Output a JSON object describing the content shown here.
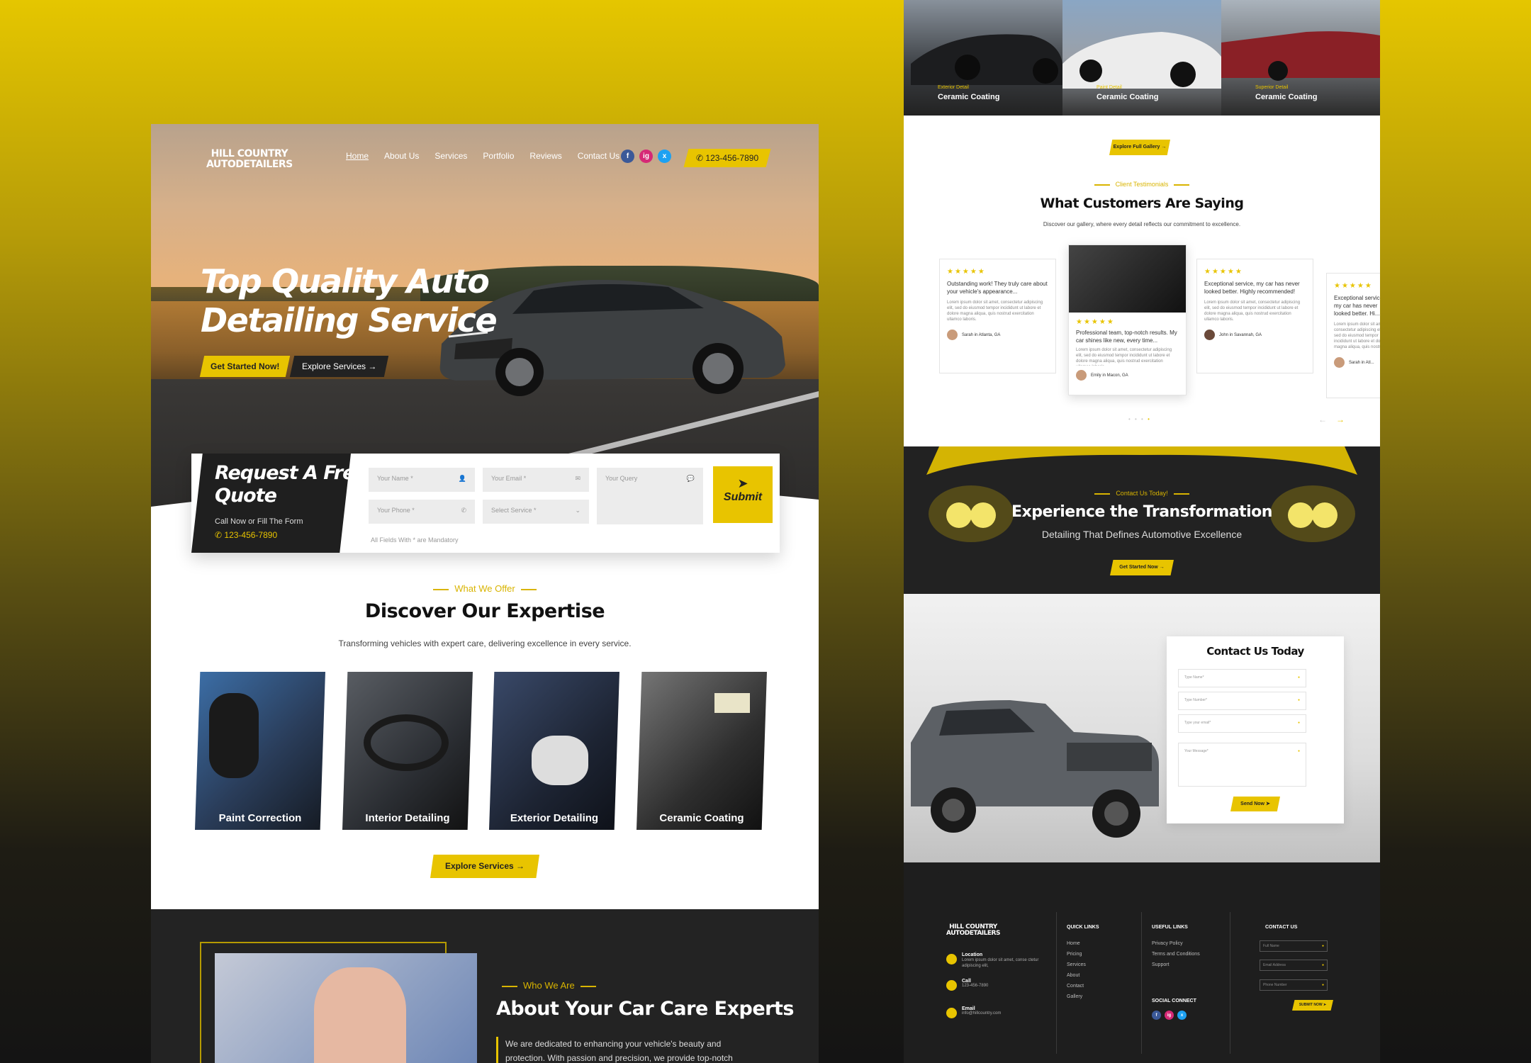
{
  "brand": {
    "line1": "HILL COUNTRY",
    "line2": "AUTODETAILERS"
  },
  "nav": [
    "Home",
    "About Us",
    "Services",
    "Portfolio",
    "Reviews",
    "Contact Us"
  ],
  "phone": "123-456-7890",
  "social": [
    "f",
    "ig",
    "x"
  ],
  "hero": {
    "title_line1": "Top Quality Auto",
    "title_line2": "Detailing Service",
    "cta_primary": "Get Started Now!",
    "cta_secondary": "Explore Services"
  },
  "quote": {
    "title_line1": "Request A Free",
    "title_line2": "Quote",
    "subtitle": "Call Now or Fill The Form",
    "phone": "123-456-7890",
    "name_placeholder": "Your Name *",
    "email_placeholder": "Your Email *",
    "query_placeholder": "Your Query",
    "phone_placeholder": "Your Phone *",
    "service_placeholder": "Select Service *",
    "note": "All Fields With * are Mandatory",
    "submit": "Submit"
  },
  "services": {
    "eyebrow": "What We Offer",
    "title": "Discover Our Expertise",
    "subtitle": "Transforming vehicles with expert care, delivering excellence in every service.",
    "cards": [
      "Paint Correction",
      "Interior Detailing",
      "Exterior Detailing",
      "Ceramic Coating"
    ],
    "button": "Explore Services"
  },
  "about": {
    "eyebrow": "Who We Are",
    "title": "About Your Car Care Experts",
    "text_line1": "We are dedicated to enhancing your vehicle's beauty and",
    "text_line2": "protection. With passion and precision, we provide top-notch"
  },
  "gallery": {
    "items": [
      {
        "tag": "Exterior Detail",
        "title": "Ceramic Coating"
      },
      {
        "tag": "Paint Detail",
        "title": "Ceramic Coating"
      },
      {
        "tag": "Superior Detail",
        "title": "Ceramic Coating"
      }
    ],
    "button": "Explore Full Gallery"
  },
  "testimonials": {
    "eyebrow": "Client Testimonials",
    "title": "What Customers Are Saying",
    "subtitle": "Discover our gallery, where every detail reflects our commitment to excellence.",
    "stars": "★★★★★",
    "lorem": "Lorem ipsum dolor sit amet, consectetur adipiscing elit, sed do eiusmod tempor incididunt ut labore et dolore magna aliqua, quis nostrud exercitation ullamco laboris.",
    "items": [
      {
        "headline": "Outstanding work! They truly care about your vehicle's appearance...",
        "author": "Sarah in Atlanta, GA"
      },
      {
        "headline": "Professional team, top-notch results. My car shines like new, every time...",
        "author": "Emily in Macon, GA"
      },
      {
        "headline": "Exceptional service, my car has never looked better. Highly recommended!",
        "author": "John in Savannah, GA"
      },
      {
        "headline": "Exceptional service, my car has never looked better. Hi...",
        "author": "Sarah in Atl..."
      }
    ]
  },
  "cta": {
    "eyebrow": "Contact Us Today!",
    "title": "Experience the Transformation",
    "subtitle": "Detailing That Defines Automotive Excellence",
    "button": "Get Started Now"
  },
  "contact": {
    "title": "Contact Us Today",
    "name": "Type Name*",
    "number": "Type Number*",
    "email": "Type your email*",
    "message": "Your Message*",
    "button": "Send Now"
  },
  "footer": {
    "location_label": "Location",
    "location_text": "Lorem ipsum dolor sit amet, conse ctetur adipiscing elit,",
    "call_label": "Call",
    "call_text": "123-456-7890",
    "email_label": "Email",
    "email_text": "info@hillcountry.com",
    "quick_title": "QUICK LINKS",
    "quick_links": [
      "Home",
      "Pricing",
      "Services",
      "About",
      "Contact",
      "Gallery"
    ],
    "useful_title": "USEFUL LINKS",
    "useful_links": [
      "Privacy Policy",
      "Terms and Conditions",
      "Support"
    ],
    "social_title": "SOCIAL CONNECT",
    "contact_title": "CONTACT US",
    "full_name": "Full Name",
    "email_address": "Email Address",
    "phone_number": "Phone Number",
    "submit": "SUBMIT NOW"
  },
  "colors": {
    "accent": "#e8c400",
    "dark": "#1f1f1f"
  }
}
